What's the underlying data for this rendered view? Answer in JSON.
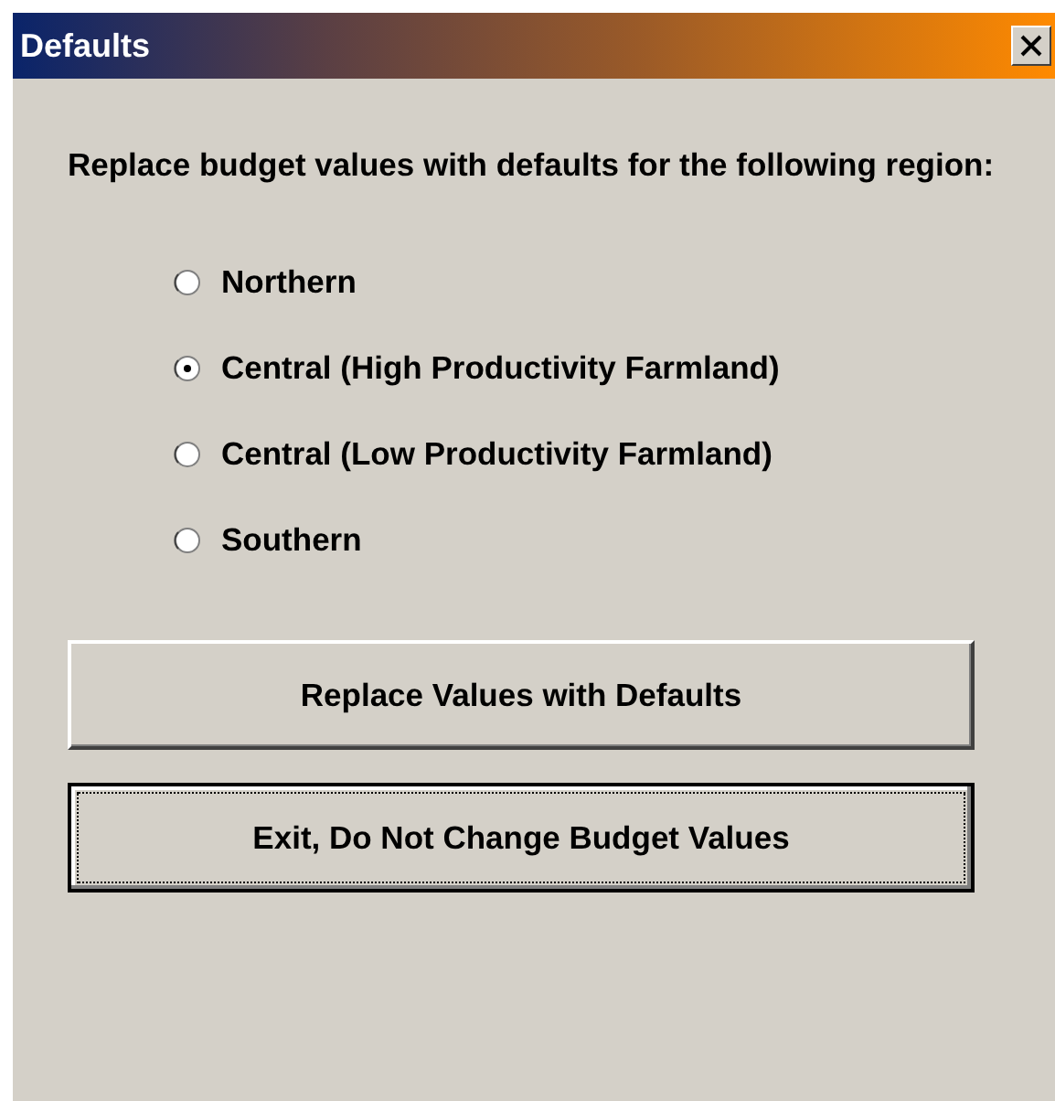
{
  "window": {
    "title": "Defaults"
  },
  "prompt": "Replace budget values with defaults for the following region:",
  "regions": [
    {
      "label": "Northern",
      "selected": false
    },
    {
      "label": "Central (High Productivity Farmland)",
      "selected": true
    },
    {
      "label": "Central (Low Productivity Farmland)",
      "selected": false
    },
    {
      "label": "Southern",
      "selected": false
    }
  ],
  "buttons": [
    {
      "label": "Replace Values with Defaults",
      "focused": false
    },
    {
      "label": "Exit, Do Not Change Budget Values",
      "focused": true
    }
  ]
}
